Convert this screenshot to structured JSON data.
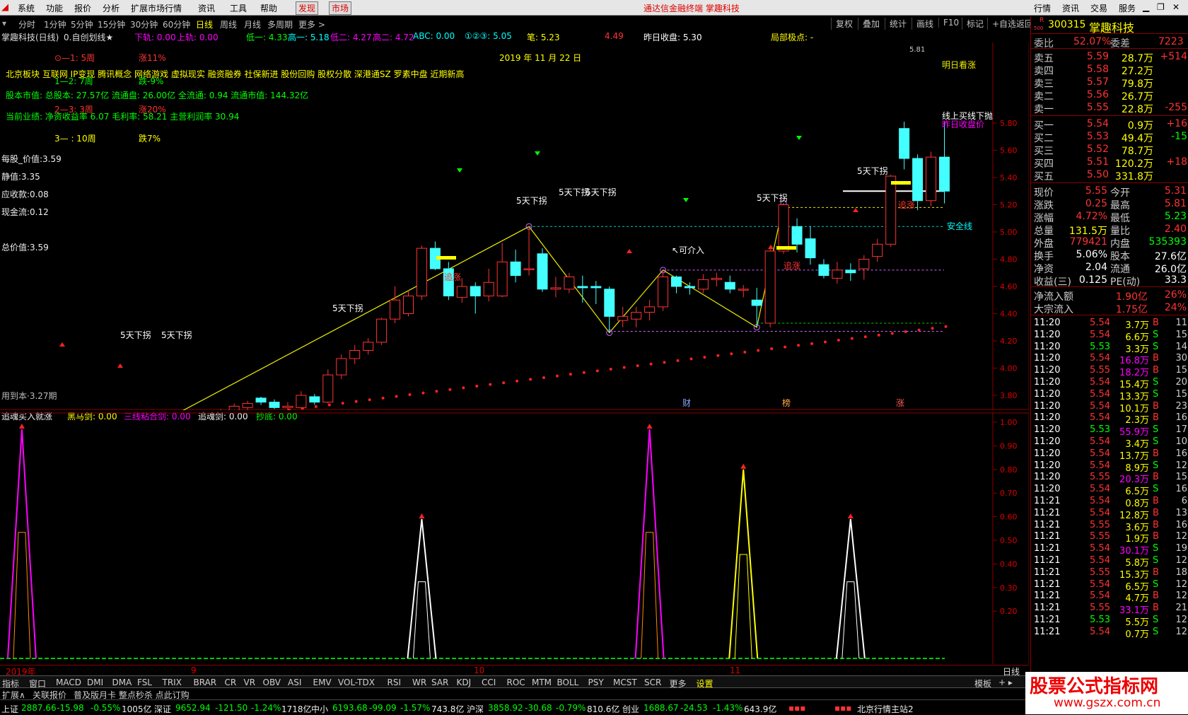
{
  "menu": {
    "items": [
      "系统",
      "功能",
      "报价",
      "分析",
      "扩展市场行情",
      "资讯",
      "工具",
      "帮助"
    ],
    "publish": "发现",
    "market": "市场",
    "title": "通达信金融终端  掌趣科技",
    "right_items": [
      "行情",
      "资讯",
      "交易",
      "服务"
    ]
  },
  "periods": {
    "items": [
      "分时",
      "1分钟",
      "5分钟",
      "15分钟",
      "30分钟",
      "60分钟",
      "日线",
      "周线",
      "月线",
      "多周期",
      "更多 >"
    ],
    "selected": "日线"
  },
  "tools": [
    "复权",
    "叠加",
    "统计",
    "画线",
    "F10",
    "标记",
    "+自选",
    "返回"
  ],
  "info": {
    "stock": "掌趣科技(日线)",
    "indicator": "0.自创划线★",
    "down": "下轨: 0.00",
    "up": "上轨: 0.00",
    "low1": "低一: 4.33",
    "high1": "高一: 5.18",
    "low2": "低二: 4.27",
    "high2": "高二: 4.72",
    "abc": "ABC: 0.00",
    "num": "①②③: 5.05",
    "bi": "笔: 5.23",
    "pct": "4.49",
    "prev": "昨日收盘: 5.30",
    "local": "局部极点: -"
  },
  "notes": {
    "n1": "⊙—1: 5周",
    "n1b": "涨11%",
    "date": "2019 年 11 月 22 日",
    "concepts": "北京板块 互联网 IP变现 腾讯概念 网络游戏 虚拟现实 融资融券 社保新进 股份回购 股权分散 深港通SZ 罗素中盘 近期新高",
    "n2": "1—2: 7周",
    "n2b": "跌-9%",
    "capital": "股本市值: 总股本: 27.57亿 流通盘: 26.00亿 全流通: 0.94 流通市值: 144.32亿",
    "n3": "2—3: 3周",
    "n3b": "涨20%",
    "perf": "当前业绩: 净资收益率 6.07 毛利率: 58.21 主营利润率 30.94",
    "n4": "3— :  10周",
    "n4b": "跌7%",
    "pershare": "每股_价值:3.59",
    "static": "静值:3.35",
    "recv": "应收款:0.08",
    "cash": "现金流:0.12",
    "total": "总价值:3.59",
    "bottom": "用到本·3.27期"
  },
  "chart_data": {
    "type": "candlestick",
    "y_ticks": [
      "5.80",
      "5.60",
      "5.40",
      "5.20",
      "5.00",
      "4.80",
      "4.60",
      "4.40",
      "4.20",
      "4.00",
      "3.80",
      "3.60",
      "3.40"
    ],
    "candles": [
      [
        3.41,
        3.44,
        3.37,
        3.45
      ],
      [
        3.44,
        3.33,
        3.32,
        3.45
      ],
      [
        3.42,
        3.42,
        3.35,
        3.46
      ],
      [
        3.55,
        3.54,
        3.49,
        3.59
      ],
      [
        3.56,
        3.59,
        3.52,
        3.61
      ],
      [
        3.51,
        3.55,
        3.49,
        3.57
      ],
      [
        3.53,
        3.52,
        3.48,
        3.55
      ],
      [
        3.49,
        3.52,
        3.48,
        3.54
      ],
      [
        3.45,
        3.42,
        3.4,
        3.5
      ],
      [
        3.49,
        3.55,
        3.47,
        3.58
      ],
      [
        3.5,
        3.56,
        3.48,
        3.58
      ],
      [
        3.56,
        3.52,
        3.5,
        3.58
      ],
      [
        3.53,
        3.51,
        3.47,
        3.56
      ],
      [
        3.49,
        3.53,
        3.47,
        3.57
      ],
      [
        3.51,
        3.55,
        3.49,
        3.61
      ],
      [
        3.56,
        3.61,
        3.54,
        3.64
      ],
      [
        3.61,
        3.66,
        3.59,
        3.7
      ],
      [
        3.69,
        3.72,
        3.66,
        3.74
      ],
      [
        3.71,
        3.74,
        3.68,
        3.76
      ],
      [
        3.78,
        3.75,
        3.73,
        3.79
      ],
      [
        3.75,
        3.71,
        3.7,
        3.77
      ],
      [
        3.71,
        3.72,
        3.69,
        3.75
      ],
      [
        3.71,
        3.8,
        3.7,
        3.83
      ],
      [
        3.79,
        3.75,
        3.73,
        3.81
      ],
      [
        3.75,
        3.95,
        3.74,
        3.99
      ],
      [
        3.95,
        4.07,
        3.92,
        4.1
      ],
      [
        4.07,
        4.13,
        4.03,
        4.17
      ],
      [
        4.13,
        4.19,
        4.1,
        4.22
      ],
      [
        4.19,
        4.36,
        4.17,
        4.37
      ],
      [
        4.36,
        4.5,
        4.33,
        4.6
      ],
      [
        4.4,
        4.53,
        4.38,
        4.57
      ],
      [
        4.53,
        4.88,
        4.5,
        4.9
      ],
      [
        4.88,
        4.73,
        4.72,
        4.93
      ],
      [
        4.73,
        4.53,
        4.5,
        4.78
      ],
      [
        4.52,
        4.6,
        4.48,
        4.66
      ],
      [
        4.6,
        4.53,
        4.4,
        4.63
      ],
      [
        4.53,
        4.63,
        4.49,
        4.73
      ],
      [
        4.53,
        4.78,
        4.52,
        4.92
      ],
      [
        4.78,
        4.68,
        4.63,
        4.87
      ],
      [
        4.73,
        4.73,
        4.68,
        5.04
      ],
      [
        4.84,
        4.58,
        4.56,
        4.88
      ],
      [
        4.58,
        4.59,
        4.52,
        4.67
      ],
      [
        4.58,
        4.67,
        4.55,
        4.7
      ],
      [
        4.6,
        4.59,
        4.48,
        4.68
      ],
      [
        4.6,
        4.59,
        4.47,
        4.64
      ],
      [
        4.58,
        4.38,
        4.26,
        4.6
      ],
      [
        4.35,
        4.38,
        4.3,
        4.45
      ],
      [
        4.36,
        4.41,
        4.3,
        4.45
      ],
      [
        4.41,
        4.45,
        4.35,
        4.5
      ],
      [
        4.45,
        4.67,
        4.42,
        4.72
      ],
      [
        4.67,
        4.6,
        4.55,
        4.68
      ],
      [
        4.6,
        4.59,
        4.54,
        4.63
      ],
      [
        4.58,
        4.65,
        4.55,
        4.69
      ],
      [
        4.65,
        4.66,
        4.6,
        4.7
      ],
      [
        4.63,
        4.58,
        4.55,
        4.68
      ],
      [
        4.58,
        4.58,
        4.52,
        4.61
      ],
      [
        4.5,
        4.46,
        4.3,
        4.59
      ],
      [
        4.33,
        4.86,
        4.3,
        4.89
      ],
      [
        4.86,
        5.2,
        4.84,
        5.21
      ],
      [
        5.04,
        4.91,
        4.85,
        5.1
      ],
      [
        4.95,
        4.81,
        4.76,
        5.04
      ],
      [
        4.76,
        4.68,
        4.66,
        4.8
      ],
      [
        4.66,
        4.72,
        4.62,
        4.78
      ],
      [
        4.72,
        4.7,
        4.64,
        4.77
      ],
      [
        4.73,
        4.8,
        4.65,
        4.83
      ],
      [
        4.82,
        4.91,
        4.78,
        4.95
      ],
      [
        4.91,
        5.41,
        4.89,
        5.42
      ],
      [
        5.76,
        5.54,
        5.46,
        5.81
      ],
      [
        5.54,
        5.23,
        5.16,
        5.57
      ],
      [
        5.23,
        5.55,
        5.19,
        5.59
      ],
      [
        5.55,
        5.3,
        5.21,
        5.81
      ]
    ],
    "zigzag": [
      [
        0,
        3.45
      ],
      [
        4,
        3.61
      ],
      [
        9,
        3.47
      ],
      [
        39,
        5.04
      ],
      [
        45,
        4.26
      ],
      [
        49,
        4.72
      ],
      [
        56,
        4.3
      ],
      [
        58,
        5.21
      ]
    ],
    "labels": [
      "5天下拐",
      "5天下拐",
      "5天下拐",
      "5天下拐",
      "5天下拐",
      "5天下拐",
      "5天下拐",
      "5天下拐"
    ],
    "annotations": [
      "追涨",
      "追涨",
      "追涨",
      "可介入",
      "明日看涨",
      "线上买线下抛",
      "昨日收盘价",
      "安全线",
      "财",
      "榜",
      "涨"
    ],
    "peak_label": "5.81"
  },
  "sub": {
    "title": "追魂买入就涨",
    "hm": "黑马剑: 0.00",
    "sx": "三线粘合剑: 0.00",
    "zh": "追魂剑: 0.00",
    "cd": "抄底: 0.00",
    "y_ticks": [
      "1.00",
      "0.90",
      "0.80",
      "0.70",
      "0.60",
      "0.50",
      "0.40",
      "0.30",
      "0.20"
    ],
    "spikes": [
      {
        "i": 1,
        "v": 0.97,
        "c": "#f0f"
      },
      {
        "i": 31,
        "v": 0.59,
        "c": "#fff"
      },
      {
        "i": 48,
        "v": 0.97,
        "c": "#f0f"
      },
      {
        "i": 55,
        "v": 0.8,
        "c": "#ff0"
      },
      {
        "i": 63,
        "v": 0.59,
        "c": "#fff"
      }
    ]
  },
  "dates": [
    "2019年",
    "9",
    "10",
    "11"
  ],
  "date_right": "日线",
  "tabs": [
    "指标",
    "窗口",
    "MACD",
    "DMI",
    "DMA",
    "FSL",
    "TRIX",
    "BRAR",
    "CR",
    "VR",
    "OBV",
    "ASI",
    "EMV",
    "VOL-TDX",
    "RSI",
    "WR",
    "SAR",
    "KDJ",
    "CCI",
    "ROC",
    "MTM",
    "BOLL",
    "PSY",
    "MCST",
    "SCR",
    "更多",
    "设置"
  ],
  "tabs_right": "模板",
  "tabs2": [
    "扩展∧",
    "关联报价",
    "普及版月卡 整点秒杀 点此订购"
  ],
  "status": {
    "sh": "上证",
    "sh_v": "2887.66",
    "sh_c": "-15.98",
    "sh_p": "-0.55%",
    "sh_a": "1005亿",
    "sz": "深证",
    "sz_v": "9652.94",
    "sz_c": "-121.50",
    "sz_p": "-1.24%",
    "sz_a": "1718亿",
    "zx": "中小",
    "zx_v": "6193.68",
    "zx_c": "-99.09",
    "zx_p": "-1.57%",
    "zx_a": "743.8亿",
    "hs": "沪深",
    "hs_v": "3858.92",
    "hs_c": "-30.68",
    "hs_p": "-0.79%",
    "hs_a": "810.6亿",
    "cy": "创业",
    "cy_v": "1688.67",
    "cy_c": "-24.53",
    "cy_p": "-1.43%",
    "cy_a": "643.9亿",
    "server": "北京行情主站2"
  },
  "quote": {
    "code": "300315",
    "name": "掌趣科技",
    "r": "R",
    "r_sub": "500",
    "wb": "委比",
    "wb_v": "52.07%",
    "wc": "委差",
    "wc_v": "7223",
    "asks": [
      [
        "卖五",
        "5.59",
        "28.7万",
        "+514"
      ],
      [
        "卖四",
        "5.58",
        "27.2万",
        ""
      ],
      [
        "卖三",
        "5.57",
        "79.8万",
        ""
      ],
      [
        "卖二",
        "5.56",
        "26.7万",
        ""
      ],
      [
        "卖一",
        "5.55",
        "22.8万",
        "-255"
      ]
    ],
    "bids": [
      [
        "买一",
        "5.54",
        "0.9万",
        "+16"
      ],
      [
        "买二",
        "5.53",
        "49.4万",
        "-15"
      ],
      [
        "买三",
        "5.52",
        "78.7万",
        ""
      ],
      [
        "买四",
        "5.51",
        "120.2万",
        "+18"
      ],
      [
        "买五",
        "5.50",
        "331.8万",
        ""
      ]
    ],
    "stats": [
      [
        "现价",
        "5.55",
        "今开",
        "5.31"
      ],
      [
        "涨跌",
        "0.25",
        "最高",
        "5.81"
      ],
      [
        "涨幅",
        "4.72%",
        "最低",
        "5.23"
      ],
      [
        "总量",
        "131.5万",
        "量比",
        "2.40"
      ],
      [
        "外盘",
        "779421",
        "内盘",
        "535393"
      ],
      [
        "换手",
        "5.06%",
        "股本",
        "27.6亿"
      ],
      [
        "净资",
        "2.04",
        "流通",
        "26.0亿"
      ],
      [
        "收益(三)",
        "0.125",
        "PE(动)",
        "33.3"
      ]
    ],
    "flow": [
      [
        "净流入额",
        "1.90亿",
        "26%"
      ],
      [
        "大宗流入",
        "1.75亿",
        "24%"
      ]
    ],
    "ticks": [
      [
        "11:20",
        "5.54",
        "3.7万",
        "B",
        "11"
      ],
      [
        "11:20",
        "5.54",
        "6.6万",
        "S",
        "15"
      ],
      [
        "11:20",
        "5.53",
        "3.3万",
        "S",
        "14"
      ],
      [
        "11:20",
        "5.54",
        "16.8万",
        "B",
        "30"
      ],
      [
        "11:20",
        "5.55",
        "18.2万",
        "B",
        "15"
      ],
      [
        "11:20",
        "5.54",
        "15.4万",
        "S",
        "20"
      ],
      [
        "11:20",
        "5.54",
        "13.3万",
        "S",
        "15"
      ],
      [
        "11:20",
        "5.54",
        "10.1万",
        "B",
        "23"
      ],
      [
        "11:20",
        "5.54",
        "2.3万",
        "B",
        "16"
      ],
      [
        "11:20",
        "5.53",
        "55.9万",
        "S",
        "17"
      ],
      [
        "11:20",
        "5.54",
        "3.4万",
        "S",
        "10"
      ],
      [
        "11:20",
        "5.54",
        "13.7万",
        "B",
        "16"
      ],
      [
        "11:20",
        "5.54",
        "8.9万",
        "S",
        "12"
      ],
      [
        "11:20",
        "5.55",
        "20.3万",
        "B",
        "15"
      ],
      [
        "11:20",
        "5.54",
        "6.5万",
        "S",
        "16"
      ],
      [
        "11:21",
        "5.54",
        "0.8万",
        "B",
        "6"
      ],
      [
        "11:21",
        "5.54",
        "12.8万",
        "B",
        "13"
      ],
      [
        "11:21",
        "5.55",
        "3.6万",
        "B",
        "16"
      ],
      [
        "11:21",
        "5.55",
        "1.9万",
        "B",
        "12"
      ],
      [
        "11:21",
        "5.54",
        "30.1万",
        "S",
        "19"
      ],
      [
        "11:21",
        "5.54",
        "5.8万",
        "S",
        "12"
      ],
      [
        "11:21",
        "5.55",
        "15.3万",
        "B",
        "18"
      ],
      [
        "11:21",
        "5.54",
        "6.5万",
        "S",
        "12"
      ],
      [
        "11:21",
        "5.54",
        "4.7万",
        "B",
        "12"
      ],
      [
        "11:21",
        "5.55",
        "33.1万",
        "B",
        "21"
      ],
      [
        "11:21",
        "5.53",
        "5.5万",
        "S",
        "12"
      ],
      [
        "11:21",
        "5.54",
        "0.7万",
        "S",
        "12"
      ]
    ]
  },
  "watermark": {
    "title": "股票公式指标网",
    "url": "www.gszx.com.cn"
  }
}
